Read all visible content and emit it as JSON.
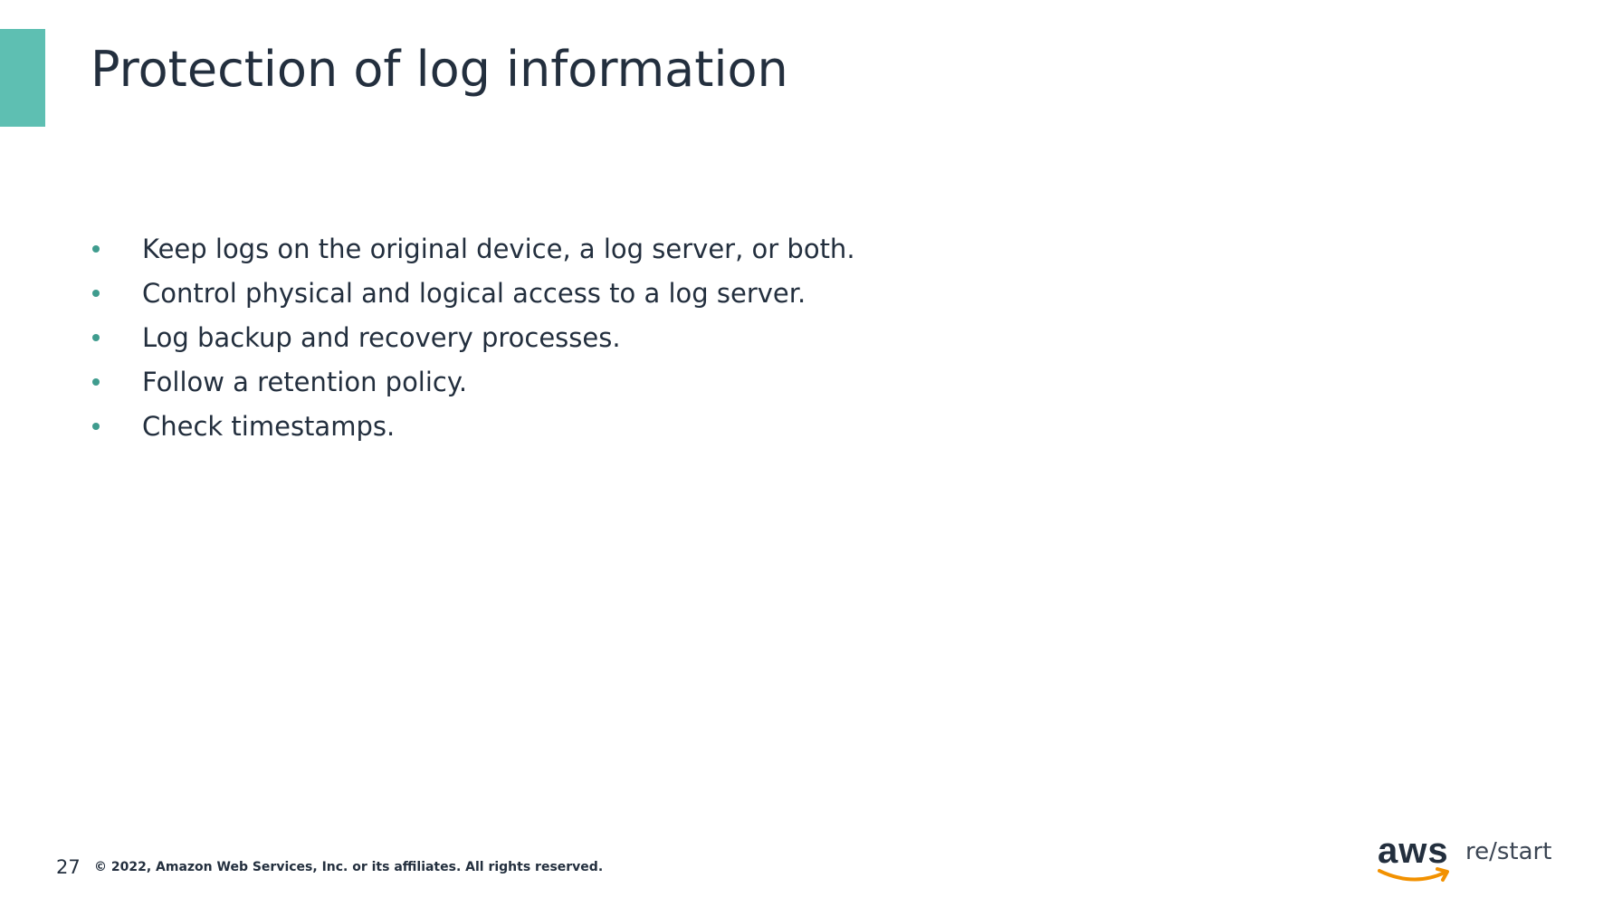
{
  "slide": {
    "title": "Protection of log information",
    "accent_color": "#5ebfb2",
    "bullet_color": "#3f9c8e",
    "bullets": [
      "Keep logs on the original device, a log server, or both.",
      "Control physical and logical access to a log server.",
      "Log backup and recovery processes.",
      "Follow a retention policy.",
      "Check timestamps."
    ]
  },
  "footer": {
    "page_number": "27",
    "copyright": "© 2022, Amazon Web Services, Inc. or its affiliates. All rights reserved."
  },
  "logo": {
    "brand": "aws",
    "product": "re/start",
    "smile_color": "#f29100"
  }
}
